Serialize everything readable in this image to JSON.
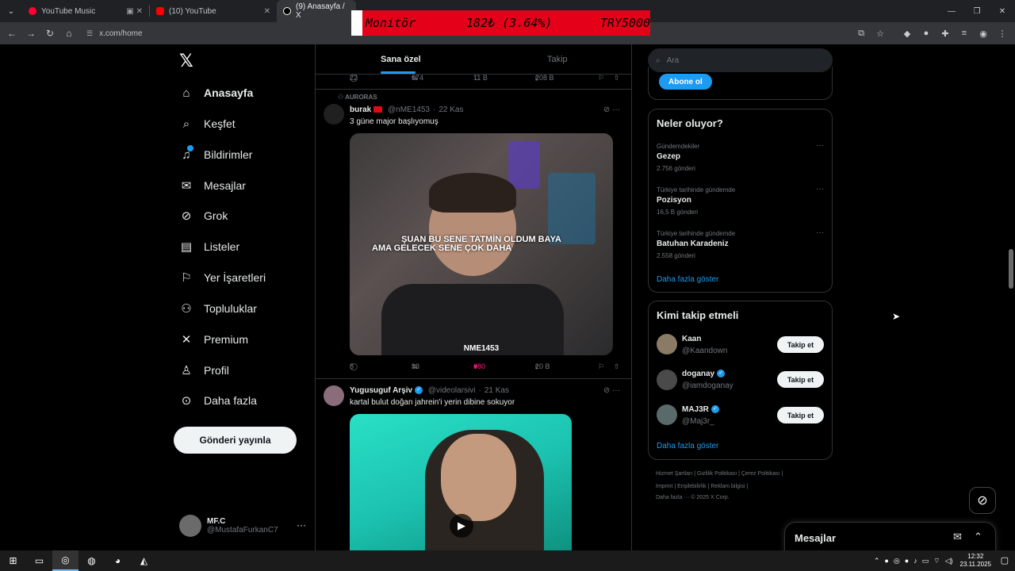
{
  "browser": {
    "tabs": [
      {
        "title": "YouTube Music",
        "active": false
      },
      {
        "title": "(10) YouTube",
        "active": false
      },
      {
        "title": "(9) Anasayfa / X",
        "active": true
      }
    ],
    "url": "x.com/home"
  },
  "monitor": {
    "name": "Monitör",
    "change": "182₺ (3.64%)",
    "price": "TRY5000"
  },
  "sidebar": {
    "items": [
      {
        "label": "Anasayfa",
        "icon": "home-icon"
      },
      {
        "label": "Keşfet",
        "icon": "search-icon"
      },
      {
        "label": "Bildirimler",
        "icon": "bell-icon"
      },
      {
        "label": "Mesajlar",
        "icon": "mail-icon"
      },
      {
        "label": "Grok",
        "icon": "grok-icon"
      },
      {
        "label": "Listeler",
        "icon": "list-icon"
      },
      {
        "label": "Yer İşaretleri",
        "icon": "bookmark-icon"
      },
      {
        "label": "Topluluklar",
        "icon": "communities-icon"
      },
      {
        "label": "Premium",
        "icon": "x-icon"
      },
      {
        "label": "Profil",
        "icon": "person-icon"
      },
      {
        "label": "Daha fazla",
        "icon": "more-circle-icon"
      }
    ],
    "post_button": "Gönderi yayınla",
    "profile": {
      "name": "MF.C",
      "handle": "@MustafaFurkanC7"
    }
  },
  "feed": {
    "tabs": [
      "Sana özel",
      "Takip"
    ],
    "top_actions": {
      "replies": "22",
      "reposts": "674",
      "likes": "11 B",
      "views": "208 B"
    },
    "tweet1": {
      "community": "AURORAS",
      "name": "burak",
      "handle": "@nME1453",
      "time": "22 Kas",
      "text": "3 güne major başlıyomuş",
      "subtitle1": "ŞUAN BU SENE TATMİN OLDUM BAYA",
      "subtitle2": "AMA GELECEK SENE ÇOK DAHA",
      "watermark": "NME1453",
      "actions": {
        "replies": "8",
        "reposts": "33",
        "likes": "680",
        "views": "20 B"
      }
    },
    "tweet2": {
      "name": "Yugusuguf Arşiv",
      "handle": "@videolarsivi",
      "time": "21 Kas",
      "text": "kartal bulut doğan jahrein'i yerin dibine sokuyor"
    }
  },
  "right": {
    "search_placeholder": "Ara",
    "subscribe_button": "Abone ol",
    "trends_title": "Neler oluyor?",
    "trends": [
      {
        "category": "Gündemdekiler",
        "name": "Gezep",
        "count": "2.756 gönderi"
      },
      {
        "category": "Türkiye tarihinde gündemde",
        "name": "Pozisyon",
        "count": "16,5 B gönderi"
      },
      {
        "category": "Türkiye tarihinde gündemde",
        "name": "Batuhan Karadeniz",
        "count": "2.558 gönderi"
      }
    ],
    "show_more": "Daha fazla göster",
    "follow_title": "Kimi takip etmeli",
    "follow": [
      {
        "name": "Kaan",
        "handle": "@Kaandown",
        "verified": false
      },
      {
        "name": "doganay",
        "handle": "@iamdoganay",
        "verified": true
      },
      {
        "name": "MAJ3R",
        "handle": "@Maj3r_",
        "verified": true
      }
    ],
    "follow_button": "Takip et",
    "footer_line1": "Hizmet Şartları  |  Gizlilik Politikası  |  Çerez Politikası  |",
    "footer_line2": "Imprint  |  Erişilebilirlik  |  Reklam bilgisi  |",
    "footer_line3": "Daha fazla ···    © 2025 X Corp."
  },
  "messages_drawer": {
    "title": "Mesajlar"
  },
  "taskbar": {
    "time": "12:32",
    "date": "23.11.2025"
  },
  "colors": {
    "accent": "#1d9bf0",
    "like": "#f91880",
    "monitor_bg": "#e5001a"
  }
}
